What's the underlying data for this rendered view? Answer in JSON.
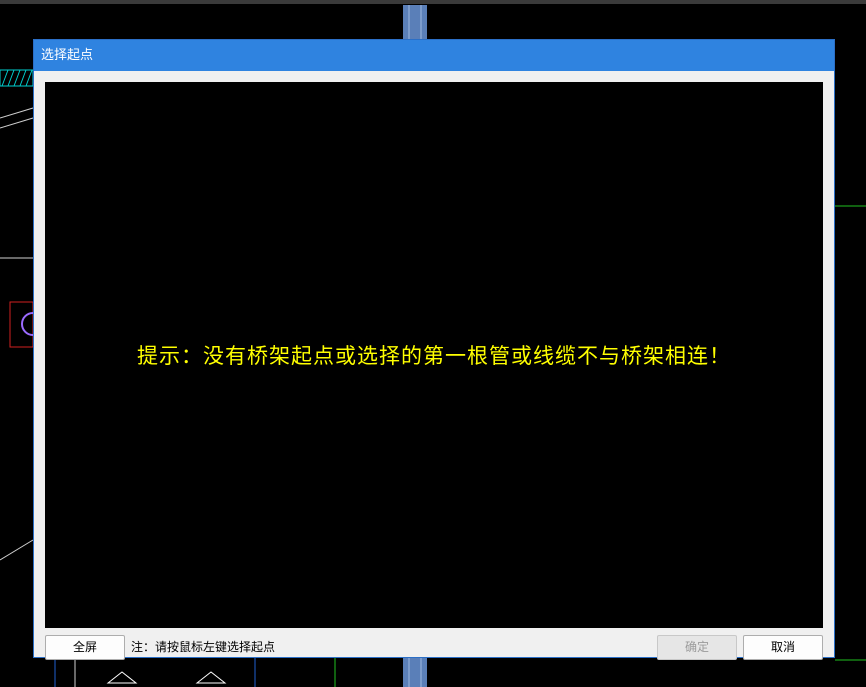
{
  "dialog": {
    "title": "选择起点",
    "message": "提示：没有桥架起点或选择的第一根管或线缆不与桥架相连！",
    "note": "注：请按鼠标左键选择起点",
    "buttons": {
      "fullscreen": "全屏",
      "ok": "确定",
      "cancel": "取消"
    },
    "ok_enabled": false
  },
  "colors": {
    "title_bar": "#2f83e0",
    "message_text": "#ffff00",
    "preview_background": "#000000"
  }
}
